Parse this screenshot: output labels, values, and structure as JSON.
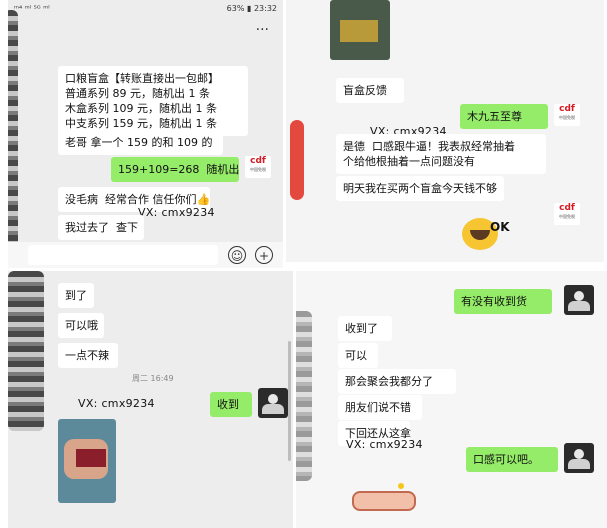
{
  "panel1": {
    "status_left": "ᵐ⁴ ᵐˡ ⁵ᴳ ᵐˡ",
    "status_right": "63% ▮ 23:32",
    "more_label": "···",
    "msg1": "口粮盲盒【转账直接出一包邮】\n普通系列 89 元，随机出 1 条\n木盒系列 109 元，随机出 1 条\n中支系列 159 元，随机出 1 条",
    "msg2": "老哥 拿一个 159 的和 109 的",
    "msg3": "159+109=268  随机出",
    "msg4": "没毛病  经常合作 信任你们👍",
    "msg5": "我过去了  查下",
    "watermark": "VX: cmx9234",
    "emoji_icon": "☺",
    "plus_icon": "+"
  },
  "panel2": {
    "msg1": "盲盒反馈",
    "msg2": "木九五至尊",
    "msg3": "是德  口感跟牛逼！我表叔经常抽着\n个给他根抽着一点问题没有",
    "msg4": "明天我在买两个盲盒今天钱不够",
    "watermark": "VX: cmx9234",
    "sticker_text": "OK"
  },
  "panel3": {
    "msg1": "到了",
    "msg2": "可以哦",
    "msg3": "一点不辣",
    "timestamp": "周二 16:49",
    "msg4": "收到",
    "watermark": "VX: cmx9234"
  },
  "panel4": {
    "msg1": "有没有收到货",
    "msg2": "收到了",
    "msg3": "可以",
    "msg4": "那会聚会我都分了",
    "msg5": "朋友们说不错",
    "msg6": "下回还从这拿",
    "msg7": "口感可以吧。",
    "watermark": "VX: cmx9234"
  },
  "brand": {
    "logo_text": "cdf",
    "logo_sub": "中国免税"
  },
  "colors": {
    "green_bubble": "#95ec69",
    "chat_bg": "#ededed"
  }
}
